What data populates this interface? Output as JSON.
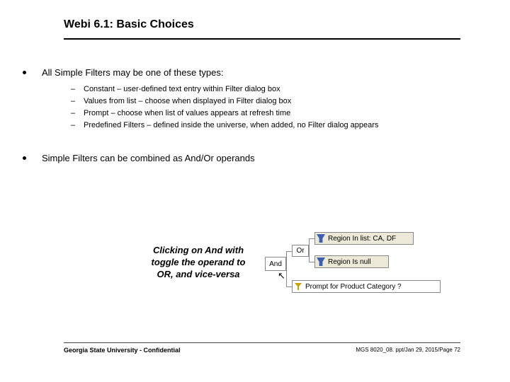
{
  "title": "Webi 6.1: Basic Choices",
  "bullet1": "All Simple Filters may be one of these types:",
  "sub": {
    "a": "Constant – user-defined text entry within Filter dialog box",
    "b": "Values from list – choose when displayed in Filter dialog box",
    "c": "Prompt – choose when list of values appears at refresh time",
    "d": "Predefined Filters – defined inside the universe, when added, no Filter dialog appears"
  },
  "bullet2": "Simple Filters can be combined as And/Or operands",
  "callout": "Clicking on And with toggle the operand to OR, and vice-versa",
  "diagram": {
    "and": "And",
    "or": "Or",
    "f1": "Region In list: CA, DF",
    "f2": "Region Is null",
    "f3": "Prompt for Product Category ?"
  },
  "footer": {
    "left": "Georgia State University - Confidential",
    "right": "MGS 8020_08. ppt/Jan 29, 2015/Page 72"
  }
}
